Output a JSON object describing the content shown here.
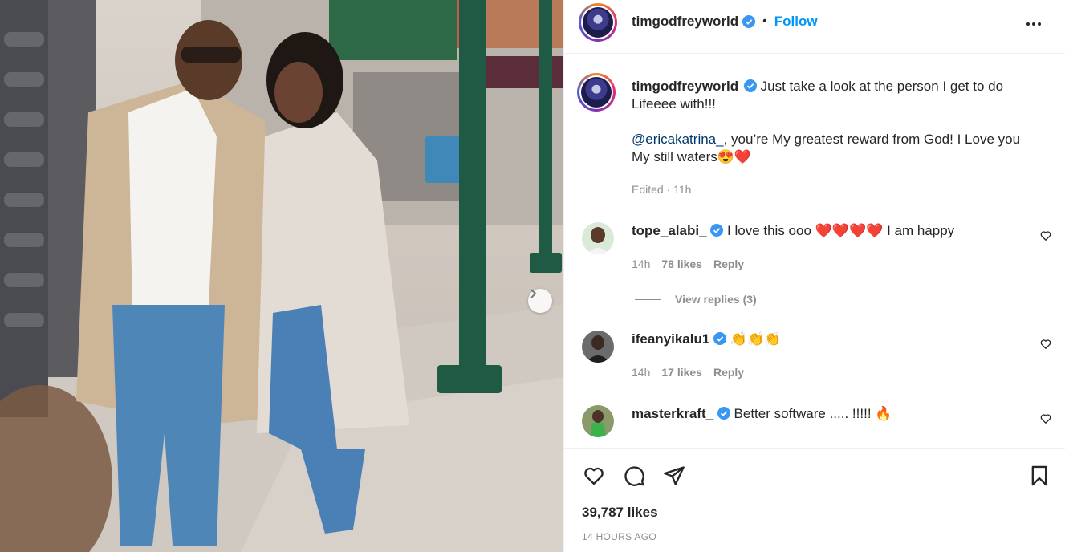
{
  "post": {
    "username": "timgodfreyworld",
    "follow_label": "Follow",
    "dot": "•",
    "caption_line1": "Just take a look at the person I get to do Lifeeee with!!!",
    "caption_mention": "@ericakatrina_",
    "caption_line2": ", you’re My greatest reward from God! I Love you My still waters😍❤️",
    "edited": "Edited · 11h",
    "likes": "39,787 likes",
    "time": "14 HOURS AGO"
  },
  "comments": [
    {
      "username": "tope_alabi_",
      "text_before": "I love this ooo",
      "emoji": "❤️❤️❤️❤️",
      "text_after": "I am happy",
      "time": "14h",
      "likes": "78 likes",
      "reply": "Reply",
      "view_replies": "View replies (3)"
    },
    {
      "username": "ifeanyikalu1",
      "emoji": "👏👏👏",
      "time": "14h",
      "likes": "17 likes",
      "reply": "Reply"
    },
    {
      "username": "masterkraft_",
      "text": "Better software ..... !!!!!",
      "emoji": "🔥"
    }
  ],
  "colors": {
    "accent": "#0095f6",
    "verified": "#3897f0",
    "muted": "#8e8e8e",
    "text": "#262626"
  },
  "icons": [
    "verified-badge-icon",
    "more-options-icon",
    "heart-icon",
    "comment-icon",
    "share-icon",
    "bookmark-icon",
    "chevron-right-icon"
  ]
}
